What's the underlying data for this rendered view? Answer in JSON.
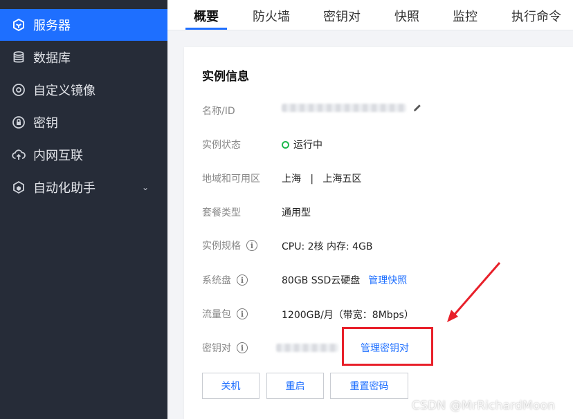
{
  "sidebar": {
    "items": [
      {
        "label": "服务器",
        "icon": "server-cube-icon",
        "active": true
      },
      {
        "label": "数据库",
        "icon": "database-icon"
      },
      {
        "label": "自定义镜像",
        "icon": "image-disc-icon"
      },
      {
        "label": "密钥",
        "icon": "key-lock-icon"
      },
      {
        "label": "内网互联",
        "icon": "network-cloud-icon"
      },
      {
        "label": "自动化助手",
        "icon": "automation-icon",
        "has_chevron": true
      }
    ]
  },
  "tabs": [
    "概要",
    "防火墙",
    "密钥对",
    "快照",
    "监控",
    "执行命令"
  ],
  "active_tab": "概要",
  "card": {
    "title": "实例信息",
    "rows": {
      "name": {
        "label": "名称/ID"
      },
      "status": {
        "label": "实例状态",
        "value": "运行中"
      },
      "region": {
        "label": "地域和可用区",
        "value": "上海   |   上海五区"
      },
      "package": {
        "label": "套餐类型",
        "value": "通用型"
      },
      "spec": {
        "label": "实例规格",
        "value": "CPU: 2核 内存: 4GB"
      },
      "disk": {
        "label": "系统盘",
        "value": "80GB SSD云硬盘",
        "link": "管理快照"
      },
      "traffic": {
        "label": "流量包",
        "value": "1200GB/月（带宽：8Mbps）"
      },
      "keypair": {
        "label": "密钥对",
        "link": "管理密钥对"
      }
    },
    "buttons": {
      "shutdown": "关机",
      "restart": "重启",
      "reset_password": "重置密码"
    }
  },
  "watermark": "CSDN @MrRichardMoon",
  "colors": {
    "accent": "#1e6fff",
    "sidebar_bg": "#262c38",
    "highlight": "#e8202a",
    "status_green": "#1fb84d"
  }
}
